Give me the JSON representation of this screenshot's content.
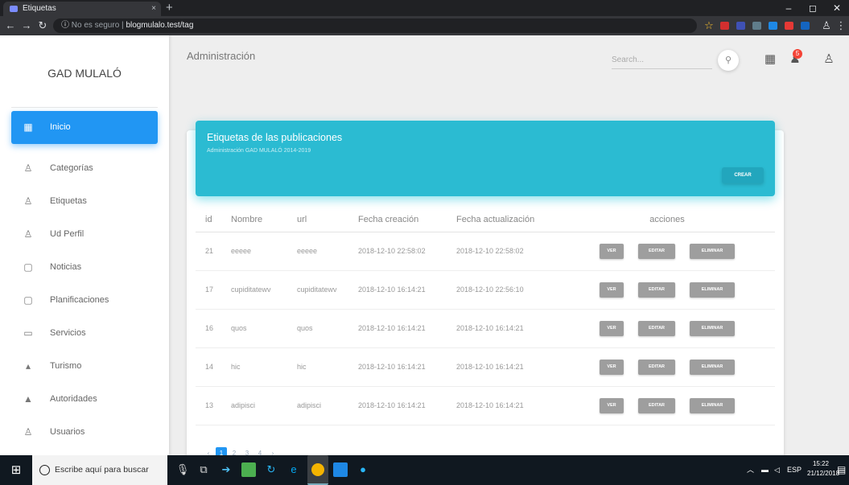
{
  "browser": {
    "tab_title": "Etiquetas",
    "tab_close": "×",
    "new_tab": "+",
    "address_security": "No es seguro",
    "address_url": "blogmulalo.test/tag",
    "window_minimize": "–",
    "window_maximize": "◻",
    "window_close": "✕"
  },
  "sidebar": {
    "brand": "GAD MULALÓ",
    "items": [
      {
        "label": "Inicio",
        "icon": "dashboard-icon",
        "glyph": "▦"
      },
      {
        "label": "Categorías",
        "icon": "person-icon",
        "glyph": "♙"
      },
      {
        "label": "Etiquetas",
        "icon": "person-icon",
        "glyph": "♙"
      },
      {
        "label": "Ud Perfil",
        "icon": "person-icon",
        "glyph": "♙"
      },
      {
        "label": "Noticias",
        "icon": "calendar-icon",
        "glyph": "▢"
      },
      {
        "label": "Planificaciones",
        "icon": "calendar-icon",
        "glyph": "▢"
      },
      {
        "label": "Servicios",
        "icon": "monitor-icon",
        "glyph": "▭"
      },
      {
        "label": "Turismo",
        "icon": "chart-icon",
        "glyph": "▴"
      },
      {
        "label": "Autoridades",
        "icon": "building-icon",
        "glyph": "▲"
      },
      {
        "label": "Usuarios",
        "icon": "person-icon",
        "glyph": "♙"
      }
    ]
  },
  "topnav": {
    "title": "Administración",
    "search_placeholder": "Search...",
    "search_glyph": "⚲",
    "apps_glyph": "▦",
    "notif_glyph": "♟",
    "notif_count": "5",
    "user_glyph": "♙"
  },
  "card": {
    "title": "Etiquetas de las publicaciones",
    "subtitle": "Administración GAD MULALÓ 2014-2019",
    "create_label": "CREAR"
  },
  "table": {
    "headers": [
      "id",
      "Nombre",
      "url",
      "Fecha creación",
      "Fecha actualización",
      "acciones"
    ],
    "rows": [
      {
        "id": "21",
        "nombre": "eeeee",
        "url": "eeeee",
        "created": "2018-12-10 22:58:02",
        "updated": "2018-12-10 22:58:02"
      },
      {
        "id": "17",
        "nombre": "cupiditatewv",
        "url": "cupiditatewv",
        "created": "2018-12-10 16:14:21",
        "updated": "2018-12-10 22:56:10"
      },
      {
        "id": "16",
        "nombre": "quos",
        "url": "quos",
        "created": "2018-12-10 16:14:21",
        "updated": "2018-12-10 16:14:21"
      },
      {
        "id": "14",
        "nombre": "hic",
        "url": "hic",
        "created": "2018-12-10 16:14:21",
        "updated": "2018-12-10 16:14:21"
      },
      {
        "id": "13",
        "nombre": "adipisci",
        "url": "adipisci",
        "created": "2018-12-10 16:14:21",
        "updated": "2018-12-10 16:14:21"
      }
    ],
    "actions": {
      "view": "VER",
      "edit": "EDITAR",
      "delete": "ELIMINAR"
    }
  },
  "pagination": {
    "prev": "‹",
    "pages": [
      "1",
      "2",
      "3",
      "4"
    ],
    "next": "›",
    "active": "1"
  },
  "taskbar": {
    "search_placeholder": "Escribe aquí para buscar",
    "time": "15:22",
    "date": "21/12/2018",
    "lang": "ESP"
  },
  "colors": {
    "primary": "#2196f3",
    "header_cyan": "#2bbbd2",
    "action_gray": "#9e9e9e",
    "badge_red": "#f44336"
  }
}
